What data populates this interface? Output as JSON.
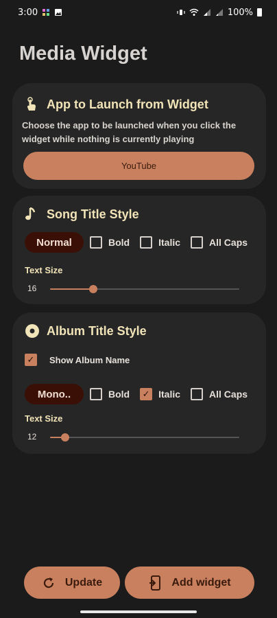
{
  "status_bar": {
    "time": "3:00",
    "battery": "100%"
  },
  "page_title": "Media Widget",
  "app_launch": {
    "icon": "touch-icon",
    "title": "App to Launch from Widget",
    "description": "Choose the app to be launched when you click the widget while nothing is currently playing",
    "button_label": "YouTube"
  },
  "song_title": {
    "icon": "music-note-icon",
    "title": "Song Title Style",
    "font_chip": "Normal",
    "options": [
      {
        "label": "Bold",
        "checked": false
      },
      {
        "label": "Italic",
        "checked": false
      },
      {
        "label": "All Caps",
        "checked": false
      }
    ],
    "text_size_label": "Text Size",
    "text_size_value": "16",
    "slider_fraction": 0.23
  },
  "album_title": {
    "icon": "disc-icon",
    "title": "Album Title Style",
    "show_album_name_label": "Show Album Name",
    "show_album_name_checked": true,
    "font_chip": "Mono..",
    "options": [
      {
        "label": "Bold",
        "checked": false
      },
      {
        "label": "Italic",
        "checked": true
      },
      {
        "label": "All Caps",
        "checked": false
      }
    ],
    "text_size_label": "Text Size",
    "text_size_value": "12",
    "slider_fraction": 0.08
  },
  "bottom_buttons": {
    "update_label": "Update",
    "add_widget_label": "Add widget"
  },
  "colors": {
    "accent": "#c8805f",
    "background": "#1b1b1b",
    "card": "#262626",
    "title_text": "#f1e4b8"
  }
}
